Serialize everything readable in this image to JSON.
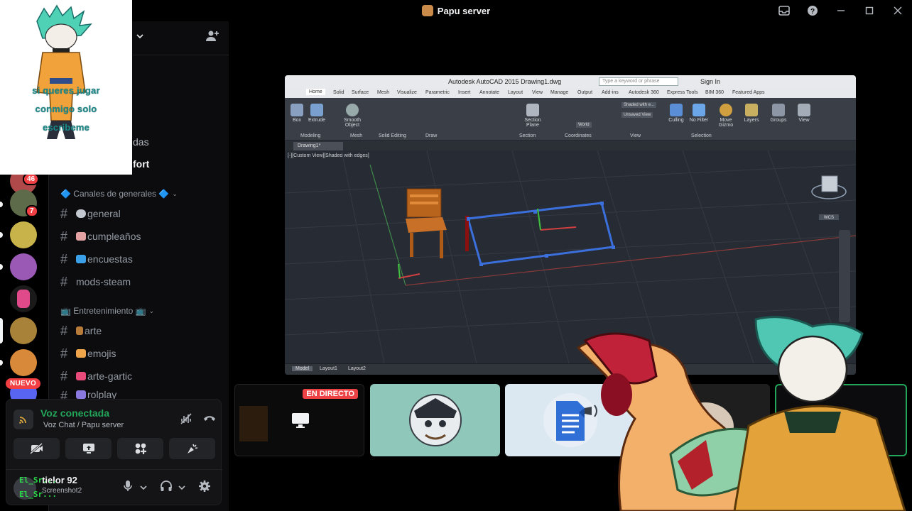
{
  "window": {
    "title": "Papu server",
    "controls": [
      "inbox-icon",
      "help-icon",
      "minimize-icon",
      "maximize-icon",
      "close-icon"
    ]
  },
  "rail": {
    "badges": [
      "46",
      "7"
    ],
    "new_label": "NUEVO"
  },
  "sticker": {
    "lines": [
      "si queres jugar",
      "conmigo solo",
      "escribeme"
    ]
  },
  "sidebar": {
    "partial_channels": [
      "das",
      "fort"
    ],
    "categories": [
      {
        "label": "🔷 Canales de generales 🔷"
      },
      {
        "label": "📺 Entretenimiento 📺"
      }
    ],
    "channels": [
      {
        "label": "general",
        "color": "#c4c9d1"
      },
      {
        "label": "cumpleaños",
        "color": "#e3a1a1"
      },
      {
        "label": "encuestas",
        "color": "#3aa0e8"
      },
      {
        "label": "mods-steam",
        "color": ""
      },
      {
        "label": "arte",
        "color": "#b97b3a"
      },
      {
        "label": "emojis",
        "color": "#f0a54a"
      },
      {
        "label": "arte-gartic",
        "color": "#e84a7a"
      },
      {
        "label": "rolplay",
        "color": "#8a7ae0"
      }
    ]
  },
  "voice": {
    "status": "Voz conectada",
    "channel": "Voz Chat / Papu server",
    "user": {
      "name": "tielor 92",
      "sub": "Screenshot2",
      "overlay": "El_Sr..."
    }
  },
  "stream": {
    "app_title": "Autodesk AutoCAD 2015   Drawing1.dwg",
    "search_placeholder": "Type a keyword or phrase",
    "sign_in": "Sign In",
    "ribbon_tabs": [
      "Home",
      "Solid",
      "Surface",
      "Mesh",
      "Visualize",
      "Parametric",
      "Insert",
      "Annotate",
      "Layout",
      "View",
      "Manage",
      "Output",
      "Add-ins",
      "Autodesk 360",
      "Express Tools",
      "BIM 360",
      "Featured Apps"
    ],
    "ribbon_groups": [
      "Modeling",
      "Mesh",
      "Solid Editing",
      "Draw",
      "Section",
      "Coordinates",
      "View",
      "Selection"
    ],
    "ribbon_tools": [
      "Box",
      "Extrude",
      "Smooth Object",
      "Section Plane",
      "Culling",
      "No Filter",
      "Move Gizmo",
      "Layers",
      "Groups",
      "View"
    ],
    "visual_style": "Shaded with e...",
    "saved_view": "Unsaved View",
    "ucs": "World",
    "file_tab": "Drawing1*",
    "viewport_label": "[-][Custom View][Shaded with edges]",
    "viewcube_label": "WCS",
    "layout_tabs": [
      "Model",
      "Layout1",
      "Layout2"
    ]
  },
  "tiles": {
    "live_label": "EN DIRECTO"
  }
}
